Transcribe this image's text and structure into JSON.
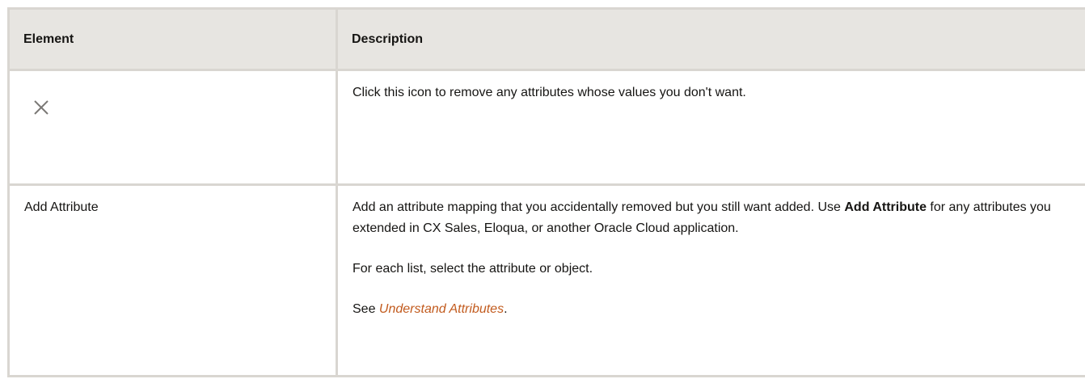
{
  "table": {
    "headers": {
      "element": "Element",
      "description": "Description"
    },
    "rows": [
      {
        "element_icon": "close-icon",
        "description": "Click this icon to remove any attributes whose values you don't want."
      },
      {
        "element": "Add Attribute",
        "p1_before": "Add an attribute mapping that you accidentally removed but you still want added. Use ",
        "p1_bold": "Add Attribute",
        "p1_after": " for any attributes you extended in CX Sales, Eloqua, or another Oracle Cloud application.",
        "p2": "For each list, select the attribute or object.",
        "p3_prefix": "See ",
        "p3_link": "Understand Attributes",
        "p3_suffix": "."
      }
    ]
  },
  "colors": {
    "header_bg": "#e7e5e1",
    "border": "#d9d6d1",
    "link": "#c25b1e"
  }
}
